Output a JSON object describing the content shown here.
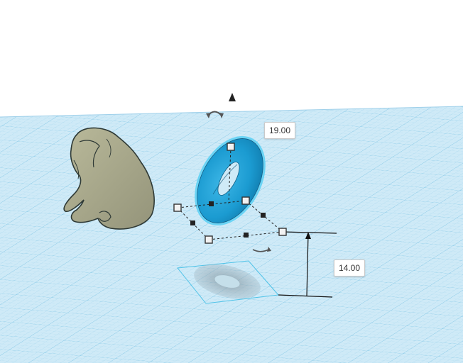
{
  "workplane": {
    "grid_fill": "#cfeaf7",
    "grid_line": "#a8d7ee",
    "grid_major": "#7cc3e4"
  },
  "selected_shape": {
    "name": "torus",
    "color": "#1b9bd1",
    "outline": "#6ad4f5"
  },
  "imported_shape": {
    "name": "sitting-figure",
    "color": "#a9a98a"
  },
  "dimensions": {
    "width_value": "19.00",
    "elevation_value": "14.00"
  },
  "icons": {
    "lift": "lift-arrow-icon",
    "rotate_top": "rotate-arrow-icon",
    "rotate_bottom": "rotate-arrow-icon"
  }
}
